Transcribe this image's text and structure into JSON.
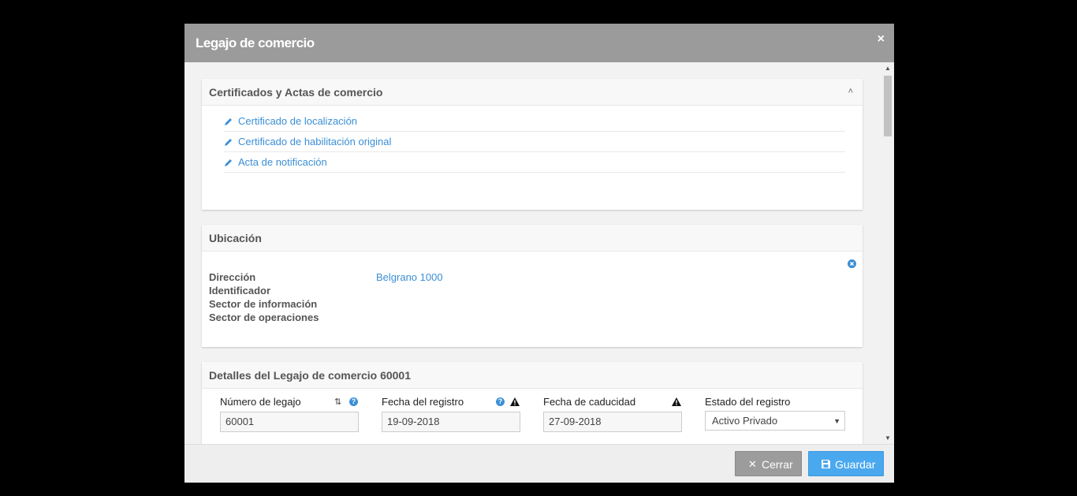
{
  "modal": {
    "title": "Legajo de comercio",
    "close_glyph": "×"
  },
  "certificados": {
    "title": "Certificados y Actas de comercio",
    "collapse_icon": "chevron-up-icon",
    "items": [
      {
        "label": "Certificado de localización",
        "icon": "pencil-icon"
      },
      {
        "label": "Certificado de habilitación original",
        "icon": "pencil-icon"
      },
      {
        "label": "Acta de notificación",
        "icon": "pencil-icon"
      }
    ]
  },
  "ubicacion": {
    "title": "Ubicación",
    "remove_icon": "remove-circle-icon",
    "rows": [
      {
        "label": "Dirección",
        "value": "Belgrano 1000"
      },
      {
        "label": "Identificador",
        "value": ""
      },
      {
        "label": "Sector de información",
        "value": ""
      },
      {
        "label": "Sector de operaciones",
        "value": ""
      }
    ]
  },
  "detalles": {
    "title": "Detalles del Legajo de comercio 60001",
    "fields": [
      {
        "label": "Número de legajo",
        "value": "60001"
      },
      {
        "label": "Fecha del registro",
        "value": "19-09-2018"
      },
      {
        "label": "Fecha de caducidad",
        "value": "27-09-2018"
      },
      {
        "label": "Estado del registro",
        "value": "Activo Privado"
      }
    ]
  },
  "footer": {
    "cancel_label": "Cerrar",
    "save_label": "Guardar",
    "cancel_icon": "close-icon",
    "save_icon": "floppy-disk-icon"
  },
  "colors": {
    "header": "#9b9b9b",
    "link": "#3b8fd6",
    "save_button": "#4aa8ee",
    "cancel_button": "#9c9c9c"
  }
}
